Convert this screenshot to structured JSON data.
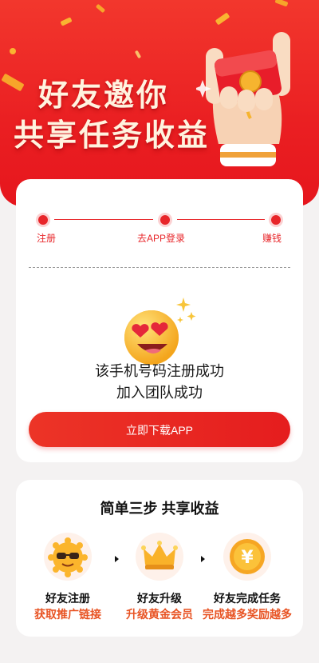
{
  "hero": {
    "title_line1": "好友邀你",
    "title_line2": "共享任务收益"
  },
  "progress": {
    "steps": [
      "注册",
      "去APP登录",
      "赚钱"
    ],
    "active_color": "#e8262a"
  },
  "result": {
    "line1": "该手机号码注册成功",
    "line2": "加入团队成功"
  },
  "download_button": "立即下载APP",
  "how_it_works": {
    "title": "简单三步  共享收益",
    "features": [
      {
        "name": "好友注册",
        "desc": "获取推广链接",
        "icon": "sunglasses-emoji-icon"
      },
      {
        "name": "好友升级",
        "desc": "升级黄金会员",
        "icon": "crown-icon"
      },
      {
        "name": "好友完成任务",
        "desc": "完成越多奖励越多",
        "icon": "yen-coin-icon"
      }
    ]
  },
  "colors": {
    "brand_red": "#e8262a",
    "accent_orange": "#e85424",
    "gold": "#f9b431"
  }
}
